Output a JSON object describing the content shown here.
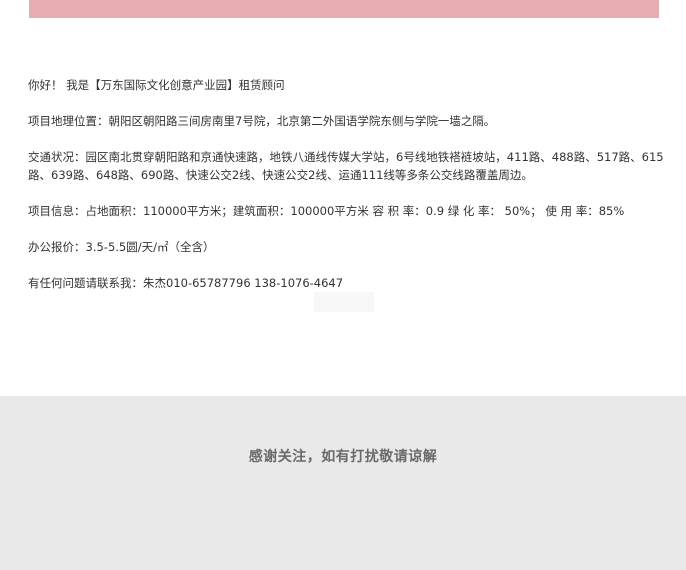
{
  "greeting": "你好！ 我是【万东国际文化创意产业园】租赁顾问",
  "location": "项目地理位置：朝阳区朝阳路三间房南里7号院，北京第二外国语学院东侧与学院一墙之隔。",
  "transport": "交通状况：园区南北贯穿朝阳路和京通快速路，地铁八通线传媒大学站，6号线地铁褡裢坡站，411路、488路、517路、615路、639路、648路、690路、快速公交2线、快速公交2线、运通111线等多条公交线路覆盖周边。",
  "project_info": "项目信息：占地面积：110000平方米；建筑面积：100000平方米  容 积 率：0.9  绿 化 率： 50%；  使 用 率：85%",
  "price": "办公报价：3.5-5.5圆/天/㎡（全含）",
  "contact": "有任何问题请联系我：朱杰010-65787796  138-1076-4647",
  "footer": {
    "thanks": "感谢关注，如有打扰敬请谅解"
  },
  "colors": {
    "banner": "#e7aeb2",
    "footer_bg": "#e9e9e9",
    "footer_text": "#6a6a6a"
  }
}
